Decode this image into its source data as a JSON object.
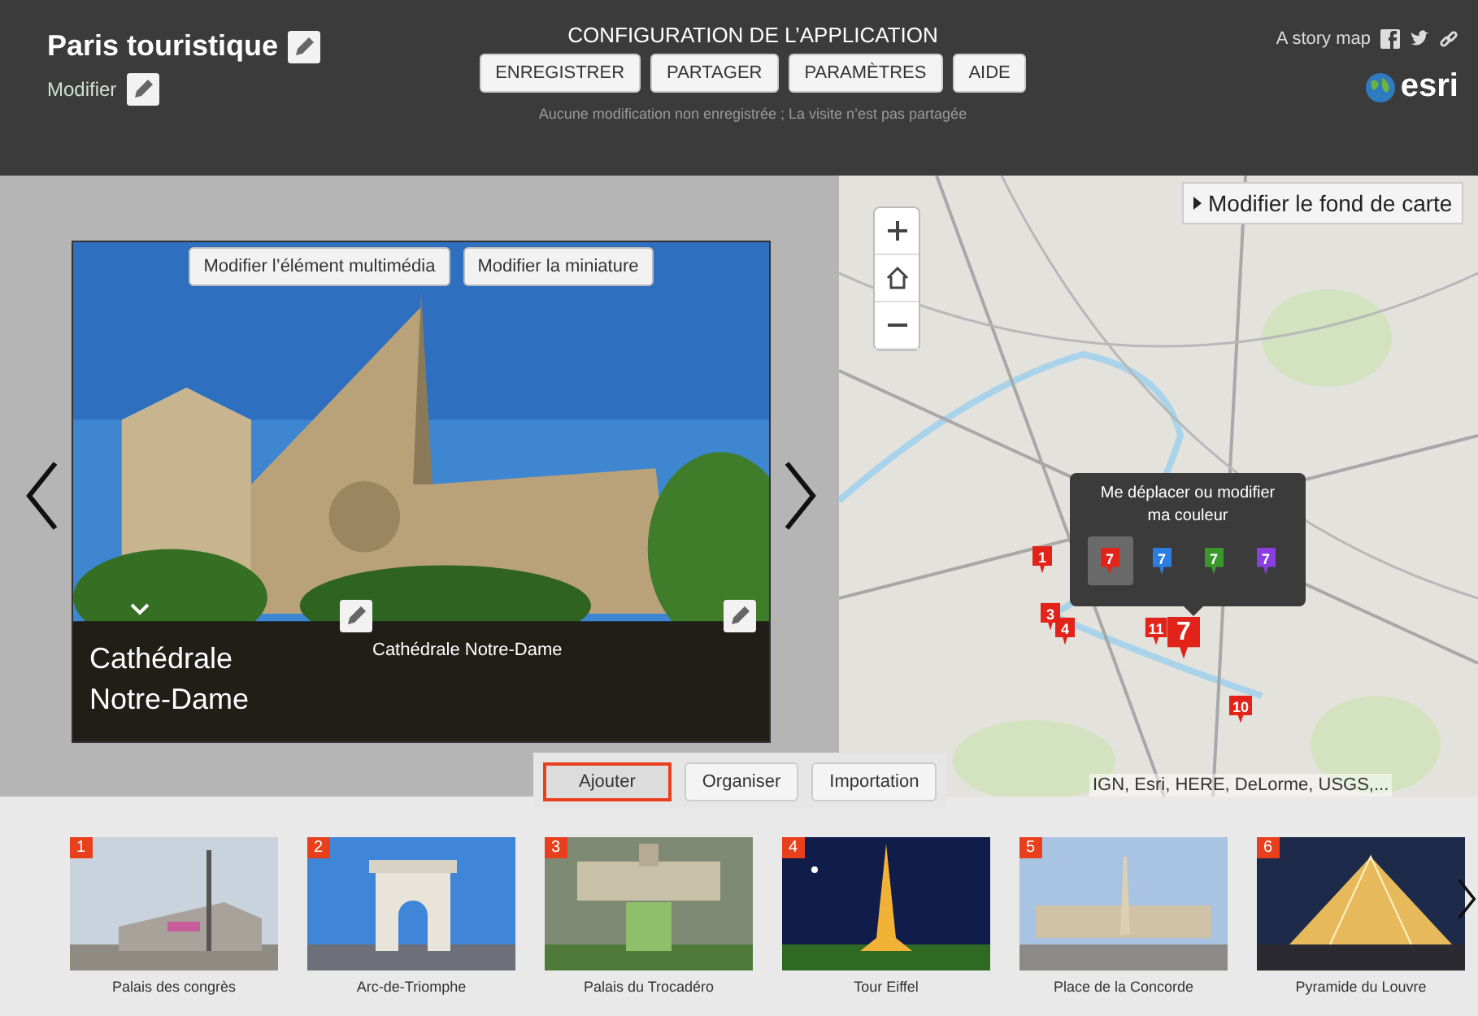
{
  "header": {
    "title": "Paris touristique",
    "edit_label": "Modifier",
    "config_title": "CONFIGURATION DE L’APPLICATION",
    "buttons": [
      "ENREGISTRER",
      "PARTAGER",
      "PARAMÈTRES",
      "AIDE"
    ],
    "status": "Aucune modification non enregistrée ; La visite n’est pas partagée",
    "story_map": "A story map",
    "brand": "esri"
  },
  "media": {
    "buttons": [
      "Modifier l’élément multimédia",
      "Modifier la miniature"
    ],
    "title": "Cathédrale Notre-Dame",
    "caption": "Cathédrale Notre-Dame"
  },
  "actions": [
    {
      "label": "Ajouter",
      "selected": true
    },
    {
      "label": "Organiser",
      "selected": false
    },
    {
      "label": "Importation",
      "selected": false
    }
  ],
  "map": {
    "basemap_button": "Modifier le fond de carte",
    "color_picker": {
      "title": "Me déplacer ou modifier ma couleur",
      "options": [
        {
          "label": "7",
          "color": "#e2231a",
          "selected": true
        },
        {
          "label": "7",
          "color": "#2b7de0",
          "selected": false
        },
        {
          "label": "7",
          "color": "#3a982a",
          "selected": false
        },
        {
          "label": "7",
          "color": "#8b3ee0",
          "selected": false
        }
      ]
    },
    "markers": [
      {
        "label": "1",
        "selected": false
      },
      {
        "label": "3",
        "selected": false
      },
      {
        "label": "4",
        "selected": false
      },
      {
        "label": "11",
        "selected": false
      },
      {
        "label": "7",
        "selected": true
      },
      {
        "label": "10",
        "selected": false
      }
    ],
    "attribution": "IGN, Esri, HERE, DeLorme, USGS,..."
  },
  "thumbnails": [
    {
      "number": "1",
      "caption": "Palais des congrès"
    },
    {
      "number": "2",
      "caption": "Arc-de-Triomphe"
    },
    {
      "number": "3",
      "caption": "Palais du Trocadéro"
    },
    {
      "number": "4",
      "caption": "Tour Eiffel"
    },
    {
      "number": "5",
      "caption": "Place de la Concorde"
    },
    {
      "number": "6",
      "caption": "Pyramide du Louvre"
    }
  ]
}
